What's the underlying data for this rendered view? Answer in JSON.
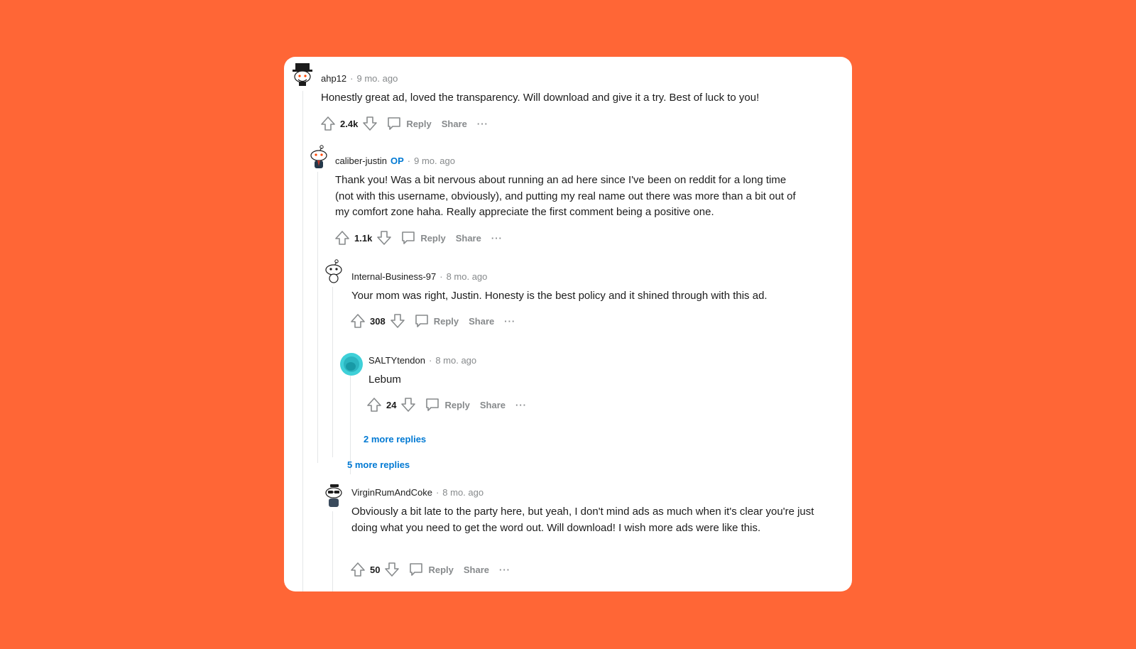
{
  "colors": {
    "background": "#ff6636",
    "card": "#ffffff",
    "link": "#0079d3",
    "muted": "#878a8c",
    "text": "#1c1c1c"
  },
  "action_labels": {
    "reply": "Reply",
    "share": "Share",
    "more": "···"
  },
  "comments": [
    {
      "author": "ahp12",
      "op": "",
      "sep": "·",
      "time": "9 mo. ago",
      "body": "Honestly great ad, loved the transparency. Will download and give it a try. Best of luck to you!",
      "score": "2.4k",
      "avatar_icon": "snoo-top-hat-icon"
    },
    {
      "author": "caliber-justin",
      "op": "OP",
      "sep": "·",
      "time": "9 mo. ago",
      "body": "Thank you! Was a bit nervous about running an ad here since I've been on reddit for a long time (not with this username, obviously), and putting my real name out there was more than a bit out of my comfort zone haha. Really appreciate the first comment being a positive one.",
      "score": "1.1k",
      "avatar_icon": "snoo-default-icon"
    },
    {
      "author": "Internal-Business-97",
      "op": "",
      "sep": "·",
      "time": "8 mo. ago",
      "body": "Your mom was right, Justin. Honesty is the best policy and it shined through with this ad.",
      "score": "308",
      "avatar_icon": "snoo-default-icon"
    },
    {
      "author": "SALTYtendon",
      "op": "",
      "sep": "·",
      "time": "8 mo. ago",
      "body": "Lebum",
      "score": "24",
      "avatar_icon": "teal-default-avatar-icon"
    },
    {
      "author": "VirginRumAndCoke",
      "op": "",
      "sep": "·",
      "time": "8 mo. ago",
      "body": "Obviously a bit late to the party here, but yeah, I don't mind ads as much when it's clear you're just doing what you need to get the word out. Will download! I wish more ads were like this.",
      "score": "50",
      "avatar_icon": "snoo-sunglasses-icon"
    }
  ],
  "more_replies": [
    {
      "label": "2 more replies"
    },
    {
      "label": "5 more replies"
    }
  ]
}
